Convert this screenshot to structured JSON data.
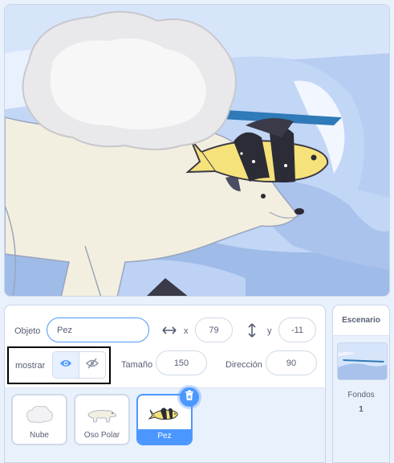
{
  "sprite_info": {
    "sprite_label": "Objeto",
    "sprite_name": "Pez",
    "x_label": "x",
    "x_value": "79",
    "y_label": "y",
    "y_value": "-11",
    "show_label": "mostrar",
    "size_label": "Tamaño",
    "size_value": "150",
    "direction_label": "Dirección",
    "direction_value": "90"
  },
  "sprites": [
    {
      "name": "Nube",
      "selected": false
    },
    {
      "name": "Oso Polar",
      "selected": false
    },
    {
      "name": "Pez",
      "selected": true
    }
  ],
  "stage_pane": {
    "title": "Escenario",
    "backdrops_label": "Fondos",
    "backdrops_count": "1"
  },
  "colors": {
    "accent": "#4c97ff",
    "text": "#575e75",
    "panel_bg": "#e9f1fc"
  },
  "icons": {
    "x": "horizontal-arrows-icon",
    "y": "vertical-arrows-icon",
    "show": "eye-icon",
    "hide": "eye-slash-icon",
    "delete": "trash-icon"
  }
}
